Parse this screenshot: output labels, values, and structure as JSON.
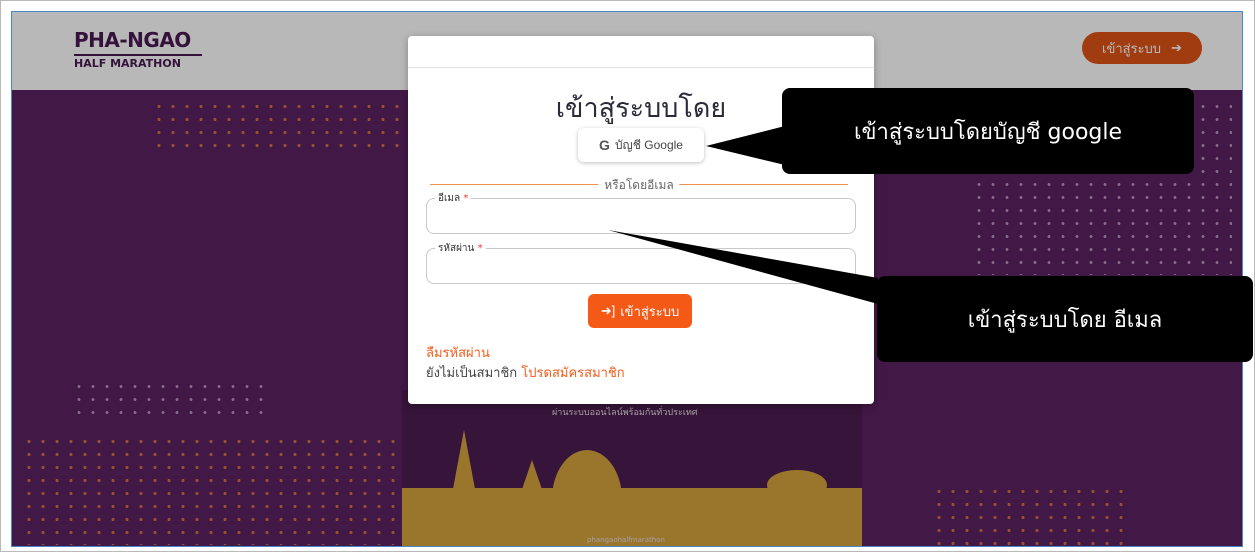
{
  "header": {
    "logo_main": "PHA-NGAO",
    "logo_sub": "HALF MARATHON",
    "login_button": "เข้าสู่ระบบ",
    "login_arrow": "➔"
  },
  "poster": {
    "tagline": "ผ่านระบบออนไลน์พร้อมกันทั่วประเทศ",
    "footer": "phangaohalfmarathon"
  },
  "modal": {
    "title": "เข้าสู่ระบบโดย",
    "google_icon": "G",
    "google_button": "บัญชี Google",
    "divider": "หรือโดยอีเมล",
    "email_label": "อีเมล",
    "password_label": "รหัสผ่าน",
    "required_mark": "*",
    "submit_icon": "➜]",
    "submit_button": "เข้าสู่ระบบ",
    "forgot_password": "ลืมรหัสผ่าน",
    "not_member": "ยังไม่เป็นสมาชิก",
    "register_link": "โปรดสมัครสมาชิก"
  },
  "callouts": {
    "google": "เข้าสู่ระบบโดยบัญชี google",
    "email": "เข้าสู่ระบบโดย อีเมล"
  },
  "colors": {
    "accent": "#f45a16",
    "brand_purple": "#4a1952",
    "callout_bg": "#000000"
  }
}
